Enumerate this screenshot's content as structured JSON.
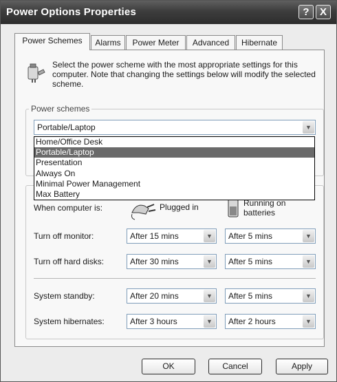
{
  "window": {
    "title": "Power Options Properties",
    "help_glyph": "?",
    "close_glyph": "X"
  },
  "tabs": [
    {
      "label": "Power Schemes",
      "active": true
    },
    {
      "label": "Alarms"
    },
    {
      "label": "Power Meter"
    },
    {
      "label": "Advanced"
    },
    {
      "label": "Hibernate"
    }
  ],
  "description": "Select the power scheme with the most appropriate settings for this computer. Note that changing the settings below will modify the selected scheme.",
  "schemes": {
    "legend": "Power schemes",
    "selected": "Portable/Laptop",
    "options": [
      "Home/Office Desk",
      "Portable/Laptop",
      "Presentation",
      "Always On",
      "Minimal Power Management",
      "Max Battery"
    ]
  },
  "settings": {
    "when_label": "When computer is:",
    "plugged_label": "Plugged in",
    "battery_label": "Running on batteries",
    "rows": [
      {
        "label": "Turn off monitor:",
        "plugged": "After 15 mins",
        "battery": "After 5 mins"
      },
      {
        "label": "Turn off hard disks:",
        "plugged": "After 30 mins",
        "battery": "After 5 mins"
      },
      {
        "label": "System standby:",
        "plugged": "After 20 mins",
        "battery": "After 5 mins"
      },
      {
        "label": "System hibernates:",
        "plugged": "After 3 hours",
        "battery": "After 2 hours"
      }
    ]
  },
  "buttons": {
    "ok": "OK",
    "cancel": "Cancel",
    "apply": "Apply"
  },
  "icons": {
    "dropdown_arrow": "chevron-down-icon"
  }
}
